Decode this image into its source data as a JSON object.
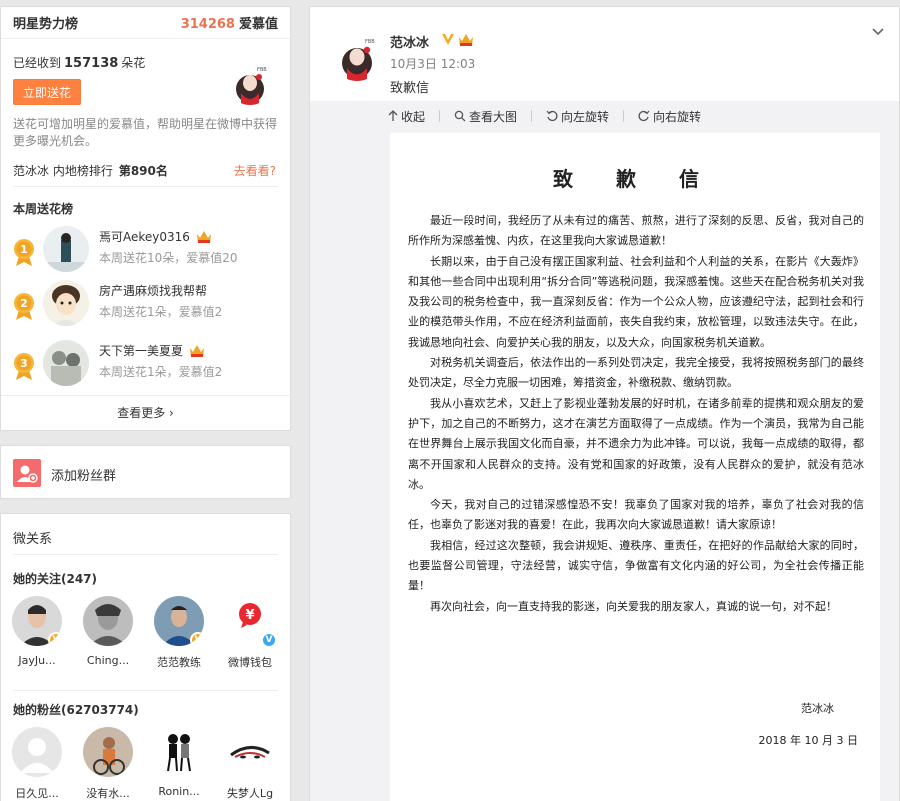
{
  "rank_card": {
    "title": "明星势力榜",
    "score": "314268",
    "score_label": "爱慕值",
    "received_prefix": "已经收到",
    "received_count": "157138",
    "received_suffix": "朵花",
    "send_button": "立即送花",
    "tip": "送花可增加明星的爱慕值，帮助明星在微博中获得更多曝光机会。",
    "ranking_label": "范冰冰 内地榜排行",
    "ranking_value": "第890名",
    "goto_link": "去看看?",
    "week_title": "本周送花榜",
    "items": [
      {
        "rank": "1",
        "name": "焉可Aekey0316",
        "stats": "本周送花10朵，爱慕值20",
        "medal_color": "#f0a425"
      },
      {
        "rank": "2",
        "name": "房产遇麻烦找我帮帮",
        "stats": "本周送花1朵，爱慕值2",
        "medal_color": "#f0a425"
      },
      {
        "rank": "3",
        "name": "天下第一美夏夏",
        "stats": "本周送花1朵，爱慕值2",
        "medal_color": "#f0a425"
      }
    ],
    "more_link": "查看更多 ›"
  },
  "fans_card": {
    "label": "添加粉丝群"
  },
  "relations": {
    "title": "微关系",
    "following_title": "她的关注(247)",
    "following": [
      {
        "name": "JayJu...",
        "badge": "V",
        "badge_color": "gold"
      },
      {
        "name": "Ching...",
        "badge": "",
        "badge_color": ""
      },
      {
        "name": "范范教练",
        "badge": "V",
        "badge_color": "gold"
      },
      {
        "name": "微博钱包",
        "badge": "V",
        "badge_color": "blue"
      }
    ],
    "fans_title": "她的粉丝(62703774)",
    "fans": [
      {
        "name": "日久见..."
      },
      {
        "name": "没有水..."
      },
      {
        "name": "Ronin..."
      },
      {
        "name": "失梦人Lg"
      }
    ]
  },
  "post": {
    "author": "范冰冰",
    "time": "10月3日 12:03",
    "text": "致歉信",
    "toolbar": {
      "collapse": "收起",
      "view_large": "查看大图",
      "rotate_left": "向左旋转",
      "rotate_right": "向右旋转"
    }
  },
  "letter": {
    "title": "致 歉 信",
    "paragraphs": [
      "最近一段时间，我经历了从未有过的痛苦、煎熬，进行了深刻的反思、反省，我对自己的所作所为深感羞愧、内疚，在这里我向大家诚恳道歉！",
      "长期以来，由于自己没有摆正国家利益、社会利益和个人利益的关系，在影片《大轰炸》和其他一些合同中出现利用“拆分合同”等逃税问题，我深感羞愧。这些天在配合税务机关对我及我公司的税务检查中，我一直深刻反省：作为一个公众人物，应该遵纪守法，起到社会和行业的模范带头作用，不应在经济利益面前，丧失自我约束，放松管理，以致违法失守。在此，我诚恳地向社会、向爱护关心我的朋友，以及大众，向国家税务机关道歉。",
      "对税务机关调查后，依法作出的一系列处罚决定，我完全接受，我将按照税务部门的最终处罚决定，尽全力克服一切困难，筹措资金，补缴税款、缴纳罚款。",
      "我从小喜欢艺术，又赶上了影视业蓬勃发展的好时机，在诸多前辈的提携和观众朋友的爱护下，加之自己的不断努力，这才在演艺方面取得了一点成绩。作为一个演员，我常为自己能在世界舞台上展示我国文化而自豪，并不遗余力为此冲锋。可以说，我每一点成绩的取得，都离不开国家和人民群众的支持。没有党和国家的好政策，没有人民群众的爱护，就没有范冰冰。",
      "今天，我对自己的过错深感惶恐不安！我辜负了国家对我的培养，辜负了社会对我的信任，也辜负了影迷对我的喜爱！在此，我再次向大家诚恳道歉！请大家原谅！",
      "我相信，经过这次整顿，我会讲规矩、遵秩序、重责任，在把好的作品献给大家的同时，也要监督公司管理，守法经营，诚实守信，争做富有文化内涵的好公司，为全社会传播正能量！",
      "再次向社会，向一直支持我的影迷，向关爱我的朋友家人，真诚的说一句，对不起！"
    ],
    "signature": "范冰冰",
    "date": "2018 年 10 月 3 日"
  }
}
